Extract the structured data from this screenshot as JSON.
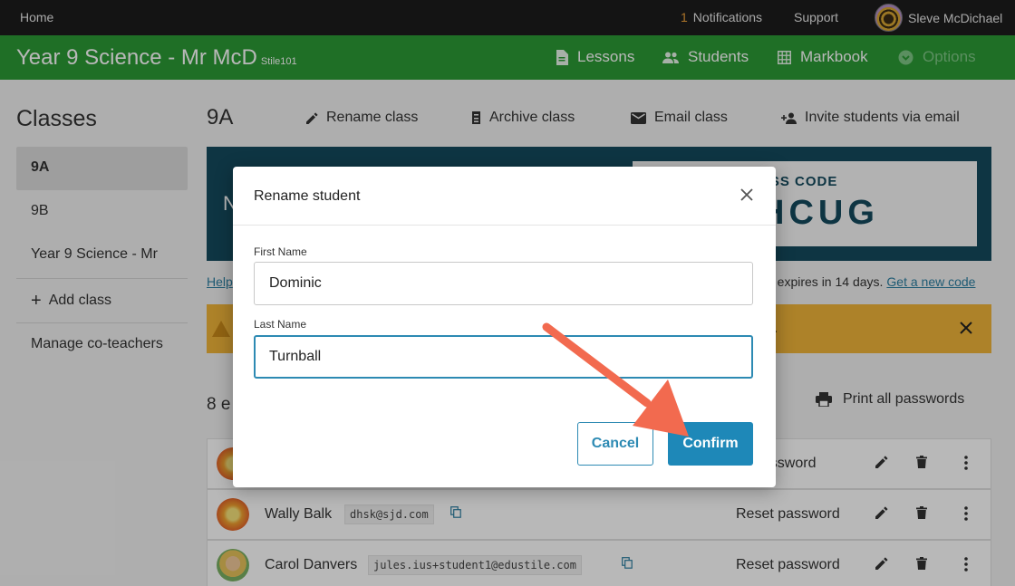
{
  "topbar": {
    "home": "Home",
    "notifications_count": "1",
    "notifications": "Notifications",
    "support": "Support",
    "user_name": "Sleve McDichael"
  },
  "header": {
    "title": "Year 9 Science - Mr McD",
    "code": "Stile101",
    "nav": {
      "lessons": "Lessons",
      "students": "Students",
      "markbook": "Markbook",
      "options": "Options"
    }
  },
  "sidebar": {
    "title": "Classes",
    "items": [
      "9A",
      "9B",
      "Year 9 Science - Mr"
    ],
    "add_class": "Add class",
    "manage": "Manage co-teachers"
  },
  "main": {
    "class_name": "9A",
    "actions": {
      "rename": "Rename class",
      "archive": "Archive class",
      "email": "Email class",
      "invite": "Invite students via email"
    },
    "banner": {
      "partial_text": "N",
      "code_label": "ASS CODE",
      "code": "HCUG"
    },
    "help_partial": "Help",
    "expires_text": "e expires in 14 days.",
    "new_code_link": "Get a new code",
    "warning_partial": ".",
    "enrolled_partial": "8 e",
    "print_all": "Print all passwords",
    "students": [
      {
        "name": "",
        "email": "",
        "reset": "password"
      },
      {
        "name": "Wally Balk",
        "email": "dhsk@sjd.com",
        "reset": "Reset password"
      },
      {
        "name": "Carol Danvers",
        "email": "jules.ius+student1@edustile.com",
        "reset": "Reset password"
      }
    ]
  },
  "modal": {
    "title": "Rename student",
    "first_label": "First Name",
    "first_value": "Dominic",
    "last_label": "Last Name",
    "last_value": "Turnball",
    "cancel": "Cancel",
    "confirm": "Confirm"
  },
  "colors": {
    "header_green": "#2c9a35",
    "banner_teal": "#144a5e",
    "warning_amber": "#f0b43a",
    "primary_blue": "#1e88b8",
    "arrow": "#f26a4f"
  }
}
